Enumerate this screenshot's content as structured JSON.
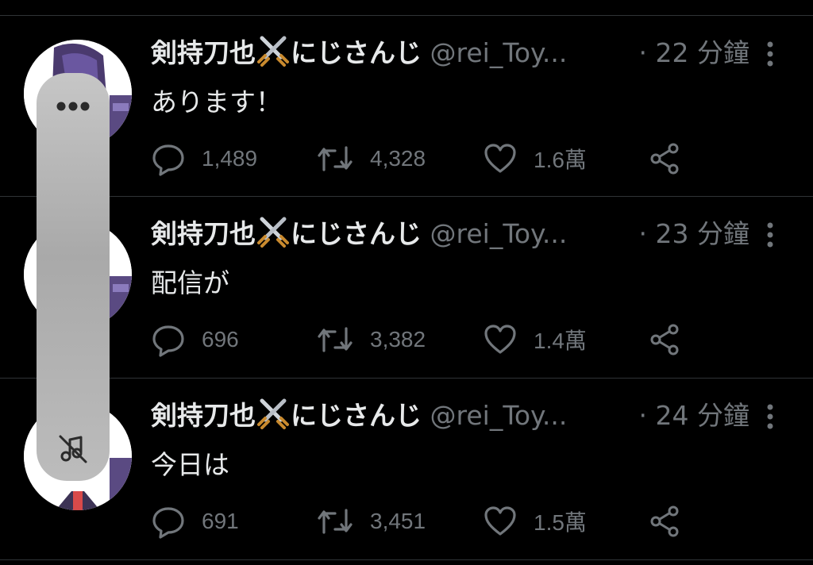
{
  "tweets": [
    {
      "name": "剣持刀也",
      "affiliation": "にじさんじ",
      "handle": "@rei_Toy...",
      "separator": "·",
      "time": "22 分鐘",
      "text": "あります！",
      "replies": "1,489",
      "retweets": "4,328",
      "likes": "1.6萬"
    },
    {
      "name": "剣持刀也",
      "affiliation": "にじさんじ",
      "handle": "@rei_Toy...",
      "separator": "·",
      "time": "23 分鐘",
      "text": "配信が",
      "replies": "696",
      "retweets": "3,382",
      "likes": "1.4萬"
    },
    {
      "name": "剣持刀也",
      "affiliation": "にじさんじ",
      "handle": "@rei_Toy...",
      "separator": "·",
      "time": "24 分鐘",
      "text": "今日は",
      "replies": "691",
      "retweets": "3,451",
      "likes": "1.5萬"
    }
  ],
  "icons": {
    "reply": "reply-icon",
    "retweet": "retweet-icon",
    "like": "heart-icon",
    "share": "share-icon",
    "more": "more-vertical-icon",
    "name_emoji": "crossed-swords-icon",
    "overlay_more": "more-horizontal-icon",
    "overlay_mute": "speaker-mute-icon"
  },
  "colors": {
    "background": "#000000",
    "text": "#e7e9ea",
    "secondary": "#71767b",
    "divider": "#2f3336"
  }
}
